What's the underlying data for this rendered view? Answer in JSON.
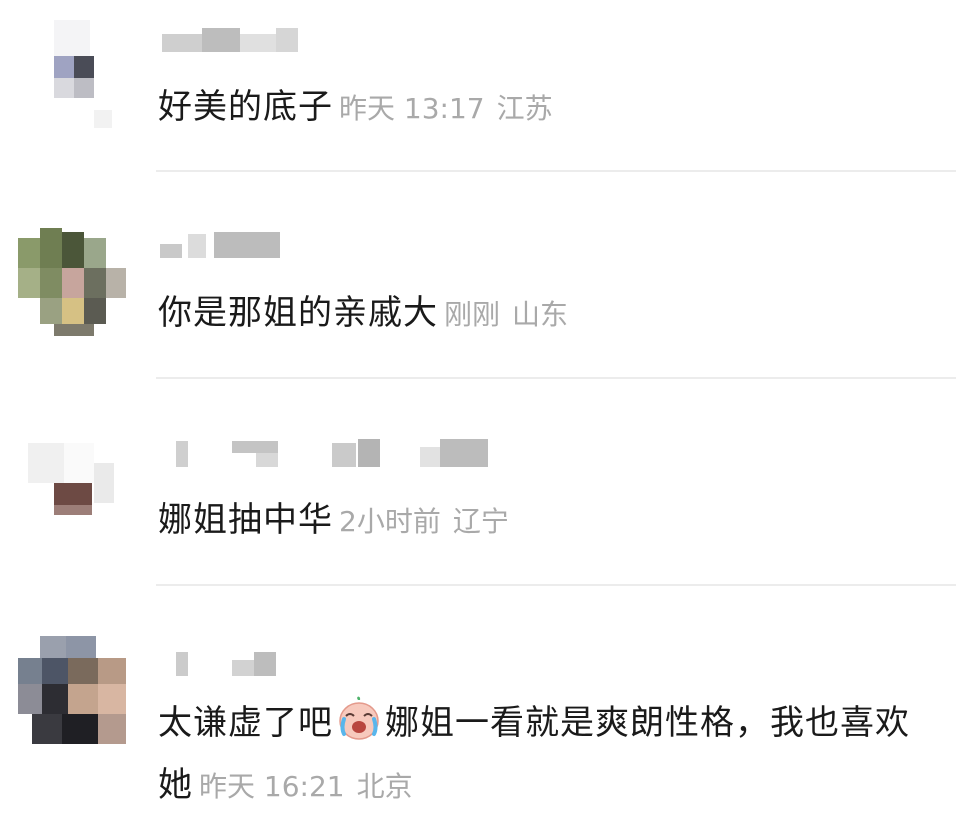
{
  "comments": [
    {
      "text": "好美的底子",
      "time": "昨天 13:17",
      "location": "江苏"
    },
    {
      "text": "你是那姐的亲戚大",
      "time": "刚刚",
      "location": "山东"
    },
    {
      "text": "娜姐抽中华",
      "time": "2小时前",
      "location": "辽宁"
    },
    {
      "text_before_emoji": "太谦虚了吧",
      "emoji": "crying-face-emoji",
      "text_after_emoji": "娜姐一看就是爽朗性格，我也喜欢她",
      "time": "昨天 16:21",
      "location": "北京"
    }
  ]
}
